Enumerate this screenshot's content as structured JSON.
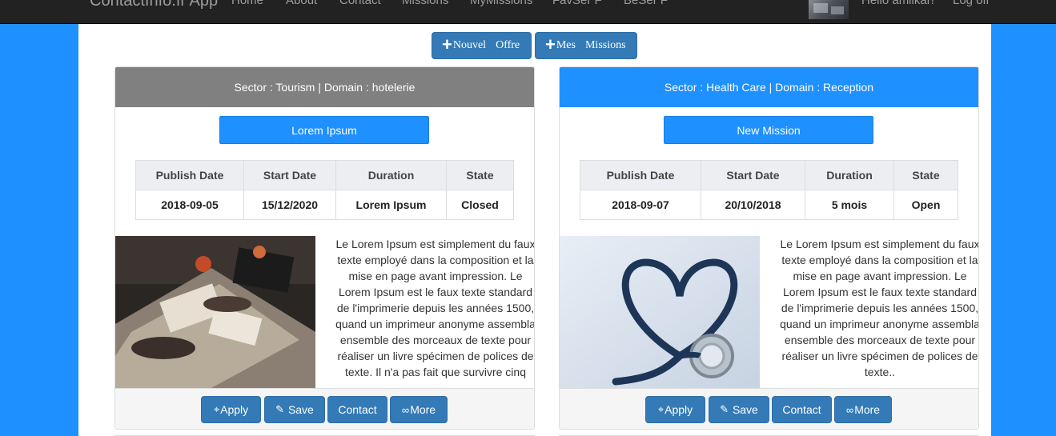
{
  "navbar": {
    "brand": "ContactInfo.fr App",
    "links": [
      "Home",
      "About",
      "Contact",
      "Missions",
      "MyMissions",
      "FavSer F",
      "BeSer F"
    ],
    "greeting": "Hello amilkar!",
    "logout": "Log off"
  },
  "top_buttons": {
    "offer": {
      "icon": "plus-icon",
      "w1": "Nouvel",
      "w2": "Offre"
    },
    "missions": {
      "icon": "plus-icon",
      "w1": "Mes",
      "w2": "Missions"
    }
  },
  "table_headers": [
    "Publish Date",
    "Start Date",
    "Duration",
    "State"
  ],
  "actions": {
    "apply": "Apply",
    "apply_icon": "crosshair-icon",
    "save": "Save",
    "save_icon": "pushpin-icon",
    "contact": "Contact",
    "more": "More",
    "more_icon": "glasses-icon"
  },
  "cards": [
    {
      "header": "Sector : Tourism | Domain : hotelerie",
      "header_color": "#808080",
      "title_button": "Lorem Ipsum",
      "row": {
        "publish_date": "2018-09-05",
        "start_date": "15/12/2020",
        "duration": "Lorem Ipsum",
        "state": "Closed"
      },
      "image": "meeting-desk-photo",
      "description": "Le Lorem Ipsum est simplement du faux texte employé dans la composition et la mise en page avant impression. Le Lorem Ipsum est le faux texte standard de l'imprimerie depuis les années 1500, quand un imprimeur anonyme assembla ensemble des morceaux de texte pour réaliser un livre spécimen de polices de texte. Il n'a pas fait que survivre cinq"
    },
    {
      "header": "Sector : Health Care | Domain : Reception",
      "header_color": "#1e90ff",
      "title_button": "New Mission",
      "row": {
        "publish_date": "2018-09-07",
        "start_date": "20/10/2018",
        "duration": "5 mois",
        "state": "Open"
      },
      "image": "heart-stethoscope-photo",
      "description": "Le Lorem Ipsum est simplement du faux texte employé dans la composition et la mise en page avant impression. Le Lorem Ipsum est le faux texte standard de l'imprimerie depuis les années 1500, quand un imprimeur anonyme assembla ensemble des morceaux de texte pour réaliser un livre spécimen de polices de texte.."
    }
  ]
}
